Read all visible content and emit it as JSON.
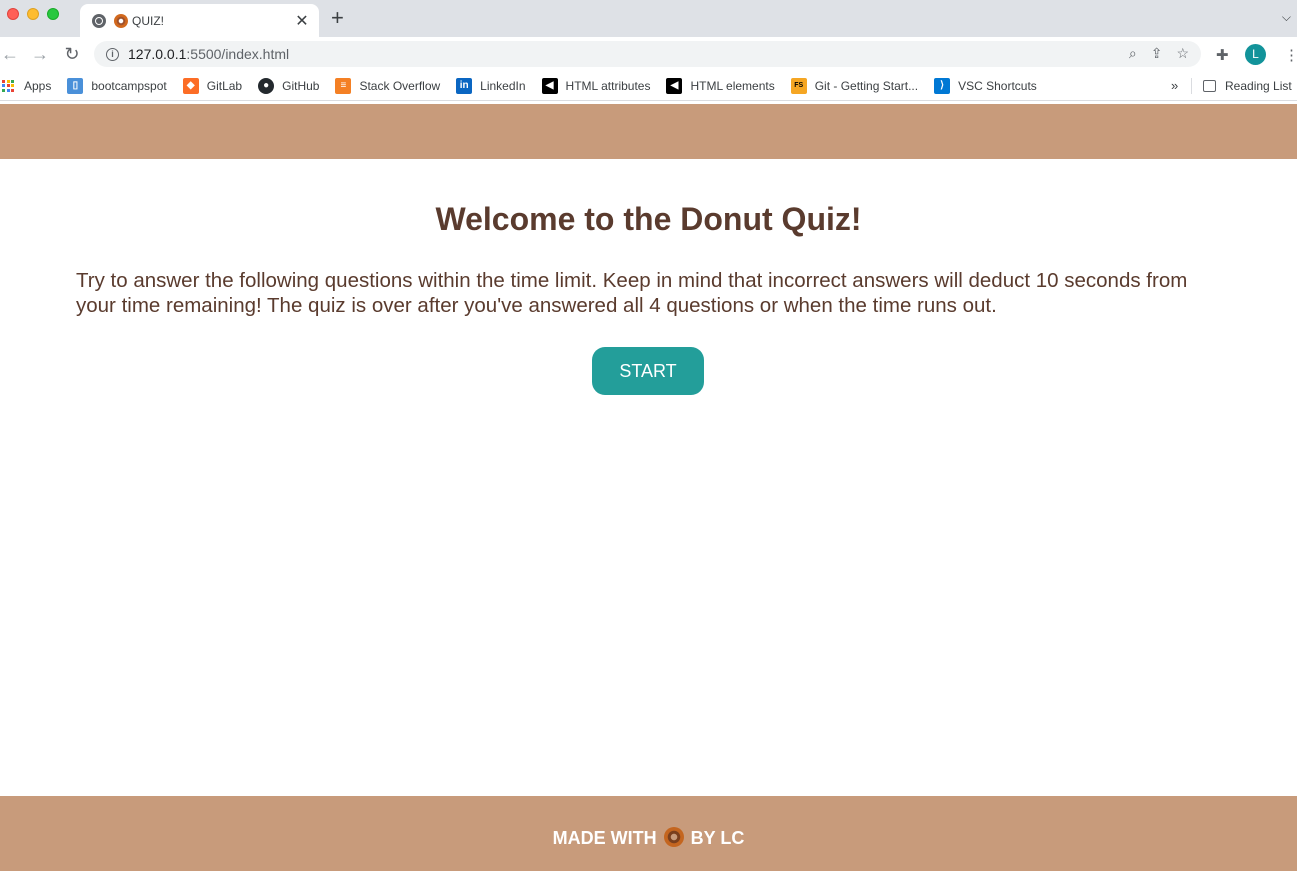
{
  "browser": {
    "tab_title": "QUIZ!",
    "tab_close": "✕",
    "new_tab": "+",
    "url_host": "127.0.0.1",
    "url_rest": ":5500/index.html",
    "avatar_letter": "L",
    "bookmarks": [
      {
        "label": "Apps",
        "icon": "apps-grid-icon"
      },
      {
        "label": "bootcampspot",
        "icon": "bootcampspot-icon",
        "color": "#4a90d9"
      },
      {
        "label": "GitLab",
        "icon": "gitlab-icon",
        "color": "#fc6d26"
      },
      {
        "label": "GitHub",
        "icon": "github-icon",
        "color": "#24292e"
      },
      {
        "label": "Stack Overflow",
        "icon": "stackoverflow-icon",
        "color": "#f48024"
      },
      {
        "label": "LinkedIn",
        "icon": "linkedin-icon",
        "color": "#0a66c2"
      },
      {
        "label": "HTML attributes",
        "icon": "html-attributes-icon",
        "color": "#000000"
      },
      {
        "label": "HTML elements",
        "icon": "html-elements-icon",
        "color": "#000000"
      },
      {
        "label": "Git - Getting Start...",
        "icon": "git-icon",
        "color": "#f5a623"
      },
      {
        "label": "VSC Shortcuts",
        "icon": "vscode-icon",
        "color": "#0078d4"
      }
    ],
    "more_bookmarks": "»",
    "reading_list": "Reading List"
  },
  "page": {
    "title": "Welcome to the Donut Quiz!",
    "intro": "Try to answer the following questions within the time limit. Keep in mind that incorrect answers will deduct 10 seconds from your time remaining! The quiz is over after you've answered all 4 questions or when the time runs out.",
    "start_label": "START",
    "footer_before": "MADE WITH",
    "footer_after": "BY LC"
  },
  "colors": {
    "header_bg": "#c89b7b",
    "text_brown": "#5a3b2e",
    "button_teal": "#239e9a"
  }
}
